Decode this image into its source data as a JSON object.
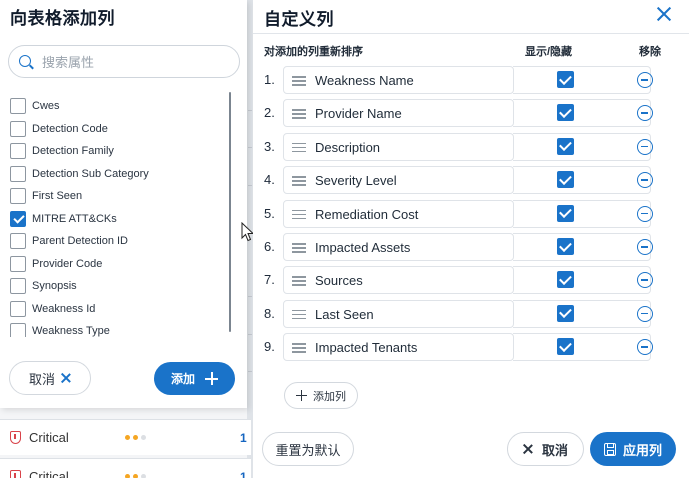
{
  "background_table": {
    "rows": [
      {
        "severity": "Critical",
        "count": "1",
        "dot_colors": [
          "#f5a623",
          "#f5a623",
          "#dcdfe3"
        ]
      },
      {
        "severity": "Critical",
        "count": "1",
        "dot_colors": [
          "#f5a623",
          "#f5a623",
          "#dcdfe3"
        ]
      }
    ]
  },
  "left_panel": {
    "title": "向表格添加列",
    "search_placeholder": "搜索属性",
    "attributes": [
      {
        "label": "Cwes",
        "checked": false
      },
      {
        "label": "Detection Code",
        "checked": false
      },
      {
        "label": "Detection Family",
        "checked": false
      },
      {
        "label": "Detection Sub Category",
        "checked": false
      },
      {
        "label": "First Seen",
        "checked": false
      },
      {
        "label": "MITRE ATT&CKs",
        "checked": true
      },
      {
        "label": "Parent Detection ID",
        "checked": false
      },
      {
        "label": "Provider Code",
        "checked": false
      },
      {
        "label": "Synopsis",
        "checked": false
      },
      {
        "label": "Weakness Id",
        "checked": false
      },
      {
        "label": "Weakness Type",
        "checked": false
      }
    ],
    "cancel_label": "取消",
    "add_label": "添加"
  },
  "right_panel": {
    "title": "自定义列",
    "header_reorder": "对添加的列重新排序",
    "header_visibility": "显示/隐藏",
    "header_remove": "移除",
    "columns": [
      {
        "index": "1.",
        "label": "Weakness Name",
        "visible": true
      },
      {
        "index": "2.",
        "label": "Provider Name",
        "visible": true
      },
      {
        "index": "3.",
        "label": "Description",
        "visible": true
      },
      {
        "index": "4.",
        "label": "Severity Level",
        "visible": true
      },
      {
        "index": "5.",
        "label": "Remediation Cost",
        "visible": true
      },
      {
        "index": "6.",
        "label": "Impacted Assets",
        "visible": true
      },
      {
        "index": "7.",
        "label": "Sources",
        "visible": true
      },
      {
        "index": "8.",
        "label": "Last Seen",
        "visible": true
      },
      {
        "index": "9.",
        "label": "Impacted Tenants",
        "visible": true
      }
    ],
    "add_column_label": "添加列",
    "reset_label": "重置为默认",
    "cancel_label": "取消",
    "apply_label": "应用列"
  },
  "colors": {
    "accent": "#1a73c9",
    "critical": "#d8434a"
  }
}
